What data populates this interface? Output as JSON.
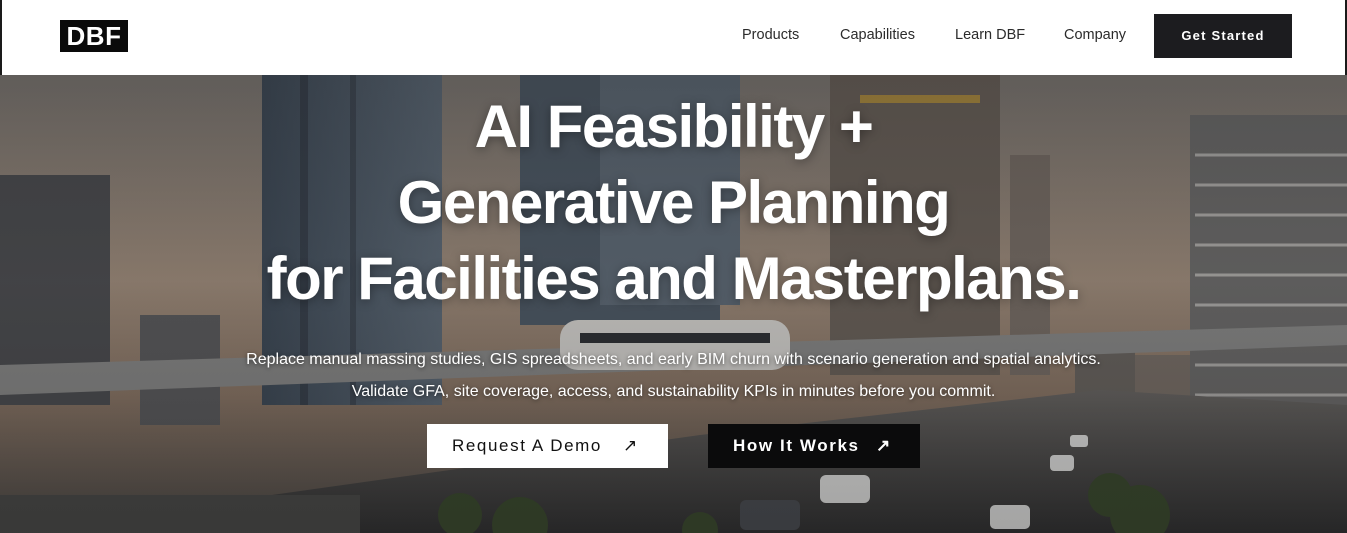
{
  "header": {
    "logo": "DBF",
    "nav": {
      "products": "Products",
      "capabilities": "Capabilities",
      "learn": "Learn DBF",
      "company": "Company"
    },
    "cta": "Get Started"
  },
  "hero": {
    "headline_lines": [
      "AI Feasibility +",
      "Generative Planning",
      "for Facilities and Masterplans."
    ],
    "subtext": "Replace manual massing studies, GIS spreadsheets, and early BIM churn with scenario generation and spatial analytics. Validate GFA, site coverage, access, and sustainability KPIs in minutes before you commit.",
    "buttons": {
      "demo": "Request A Demo",
      "how": "How It Works",
      "arrow": "↗"
    },
    "background_icon": "city-skyline-image"
  },
  "colors": {
    "brand_dark": "#0a0a0a",
    "header_bg": "#ffffff",
    "cta_bg": "#1c1c1f",
    "hero_text": "#ffffff"
  }
}
